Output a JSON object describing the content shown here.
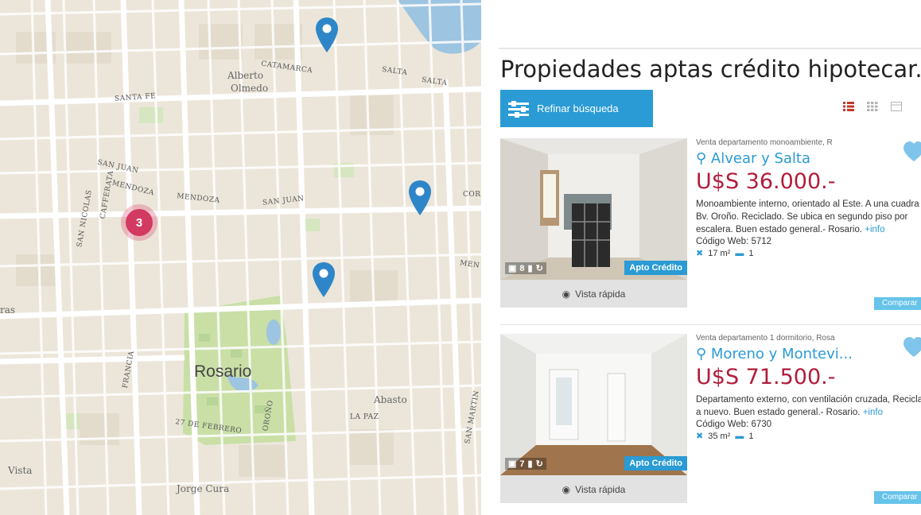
{
  "map": {
    "streets": [
      "SANTA FE",
      "SAN JUAN",
      "MENDOZA",
      "MENDOZA",
      "SAN JUAN",
      "SAN NICOLAS",
      "CAFFERATA",
      "FRANCIA",
      "OROÑO",
      "27 DE FEBRERO",
      "LA PAZ",
      "SAN MARTIN",
      "SALTA",
      "SALTA",
      "CATAMARCA",
      "COR",
      "MEN"
    ],
    "places": [
      "Alberto",
      "Olmedo",
      "Abasto",
      "Jorge Cura",
      "Vista",
      "ras"
    ],
    "city": "Rosario",
    "cluster_count": "3",
    "colors": {
      "pin": "#2e86c9",
      "cluster": "#d23a62",
      "park": "#c9dfa6",
      "water": "#9dc4e0"
    }
  },
  "listings": {
    "title": "Propiedades aptas crédito hipotecar..",
    "refine_label": "Refinar búsqueda",
    "view_icons": [
      "list-view-icon",
      "grid-view-icon",
      "map-view-icon"
    ],
    "items": [
      {
        "operation": "Venta departamento monoambiente, R",
        "address": "Alvear y Salta",
        "price": "U$S 36.000.-",
        "description": "Monoambiente interno, orientado al Este. A una cuadra de Bv. Oroño. Reciclado. Se ubica en segundo piso por escalera. Buen estado general.- Rosario.",
        "more": "+info",
        "code": "Código Web: 5712",
        "area": "17 m²",
        "baths": "1",
        "photos": "8",
        "badge": "Apto Crédito",
        "quick_view": "Vista rápida",
        "compare": "Comparar"
      },
      {
        "operation": "Venta departamento 1 dormitorio, Rosa",
        "address": "Moreno y Montevi...",
        "price": "U$S 71.500.-",
        "description": "Departamento externo, con ventilación cruzada, Reciclado a nuevo. Buen estado general.- Rosario.",
        "more": "+info",
        "code": "Código Web: 6730",
        "area": "35 m²",
        "baths": "1",
        "photos": "7",
        "badge": "Apto Crédito",
        "quick_view": "Vista rápida",
        "compare": "Comparar"
      }
    ],
    "colors": {
      "accent": "#2a9bd4",
      "price": "#b01d3a"
    }
  }
}
